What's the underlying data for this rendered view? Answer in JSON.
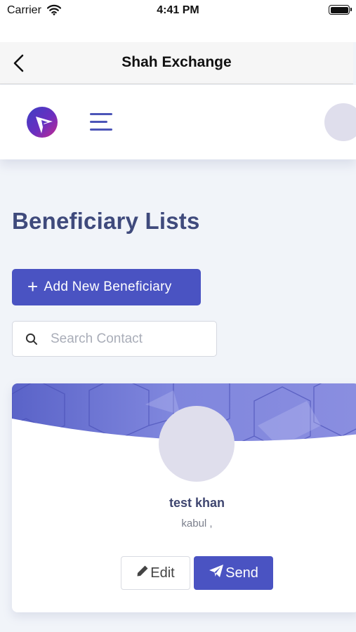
{
  "status_bar": {
    "carrier": "Carrier",
    "time": "4:41 PM",
    "battery_level": 1.0,
    "wifi_icon": "wifi-icon",
    "battery_icon": "battery-icon"
  },
  "nav": {
    "title": "Shah Exchange",
    "back_icon": "chevron-left-icon"
  },
  "header": {
    "logo_icon": "app-logo",
    "menu_icon": "hamburger-menu-icon",
    "profile_avatar": "avatar"
  },
  "main": {
    "page_title": "Beneficiary Lists",
    "add_button_label": "Add New Beneficiary",
    "add_button_icon": "plus-icon",
    "search": {
      "placeholder": "Search Contact",
      "value": ""
    }
  },
  "beneficiaries": [
    {
      "name": "test khan",
      "location": "kabul ,",
      "edit_label": "Edit",
      "send_label": "Send",
      "edit_icon": "pencil-icon",
      "send_icon": "paper-plane-icon"
    }
  ],
  "colors": {
    "accent": "#4a53c2",
    "title": "#3f4a7c",
    "background": "#f1f4f9",
    "avatar": "#dfdeec"
  }
}
